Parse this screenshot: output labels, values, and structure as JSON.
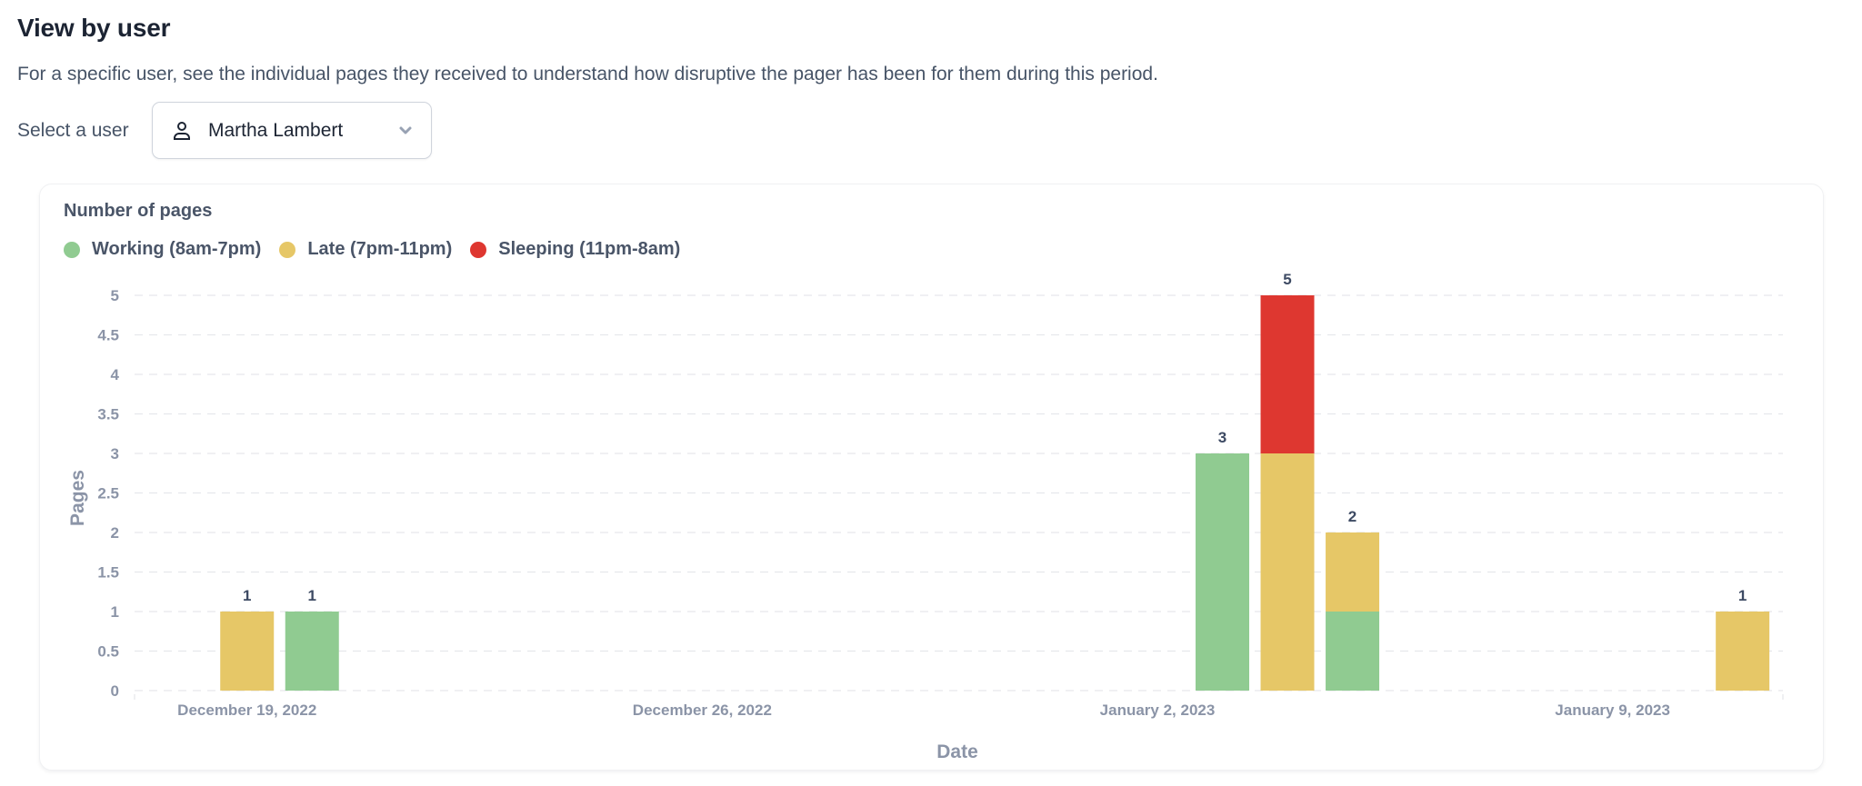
{
  "header": {
    "title": "View by user",
    "description": "For a specific user, see the individual pages they received to understand how disruptive the pager has been for them during this period."
  },
  "user_select": {
    "label": "Select a user",
    "value": "Martha Lambert",
    "icon": "user-icon",
    "chevron_icon": "chevron-down-icon"
  },
  "colors": {
    "working": "#90CB91",
    "late": "#E6C767",
    "sleeping": "#DE3730"
  },
  "chart_data": {
    "type": "bar",
    "stacked": true,
    "title": "Number of pages",
    "xlabel": "Date",
    "ylabel": "Pages",
    "ylim": [
      0,
      5
    ],
    "yticks": [
      "0",
      "0.5",
      "1",
      "1.5",
      "2",
      "2.5",
      "3",
      "3.5",
      "4",
      "4.5",
      "5"
    ],
    "grid": true,
    "legend_position": "top-left",
    "x_range_days": [
      "2022-12-18",
      "2023-01-12"
    ],
    "xticks": [
      {
        "date": "2022-12-19",
        "label": "December 19, 2022"
      },
      {
        "date": "2022-12-26",
        "label": "December 26, 2022"
      },
      {
        "date": "2023-01-02",
        "label": "January 2, 2023"
      },
      {
        "date": "2023-01-09",
        "label": "January 9, 2023"
      }
    ],
    "legend": [
      {
        "key": "working",
        "label": "Working (8am-7pm)"
      },
      {
        "key": "late",
        "label": "Late (7pm-11pm)"
      },
      {
        "key": "sleeping",
        "label": "Sleeping (11pm-8am)"
      }
    ],
    "categories": [
      "2022-12-19",
      "2022-12-20",
      "2023-01-03",
      "2023-01-04",
      "2023-01-05",
      "2023-01-11"
    ],
    "series": [
      {
        "name": "Working (8am-7pm)",
        "key": "working",
        "values": [
          0,
          1,
          3,
          0,
          1,
          0
        ]
      },
      {
        "name": "Late (7pm-11pm)",
        "key": "late",
        "values": [
          1,
          0,
          0,
          3,
          1,
          1
        ]
      },
      {
        "name": "Sleeping (11pm-8am)",
        "key": "sleeping",
        "values": [
          0,
          0,
          0,
          2,
          0,
          0
        ]
      }
    ],
    "totals": [
      1,
      1,
      3,
      5,
      2,
      1
    ]
  }
}
